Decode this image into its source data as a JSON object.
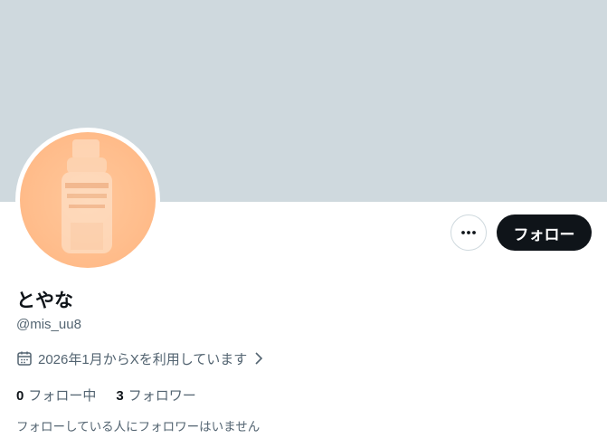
{
  "profile": {
    "display_name": "とやな",
    "handle": "@mis_uu8",
    "joined_text": "2026年1月からXを利用しています",
    "follow_label": "フォロー",
    "following_count": "0",
    "following_label": "フォロー中",
    "followers_count": "3",
    "followers_label": "フォロワー",
    "mutual_followers_text": "フォローしている人にフォロワーはいません"
  },
  "icons": {
    "more": "more-horizontal-icon",
    "calendar": "calendar-icon",
    "chevron": "chevron-right-icon"
  },
  "colors": {
    "banner": "#cfd9de",
    "primary_text": "#0f1419",
    "secondary_text": "#536471",
    "follow_button_bg": "#0f1419",
    "avatar_bg": "#ffbd8c"
  }
}
